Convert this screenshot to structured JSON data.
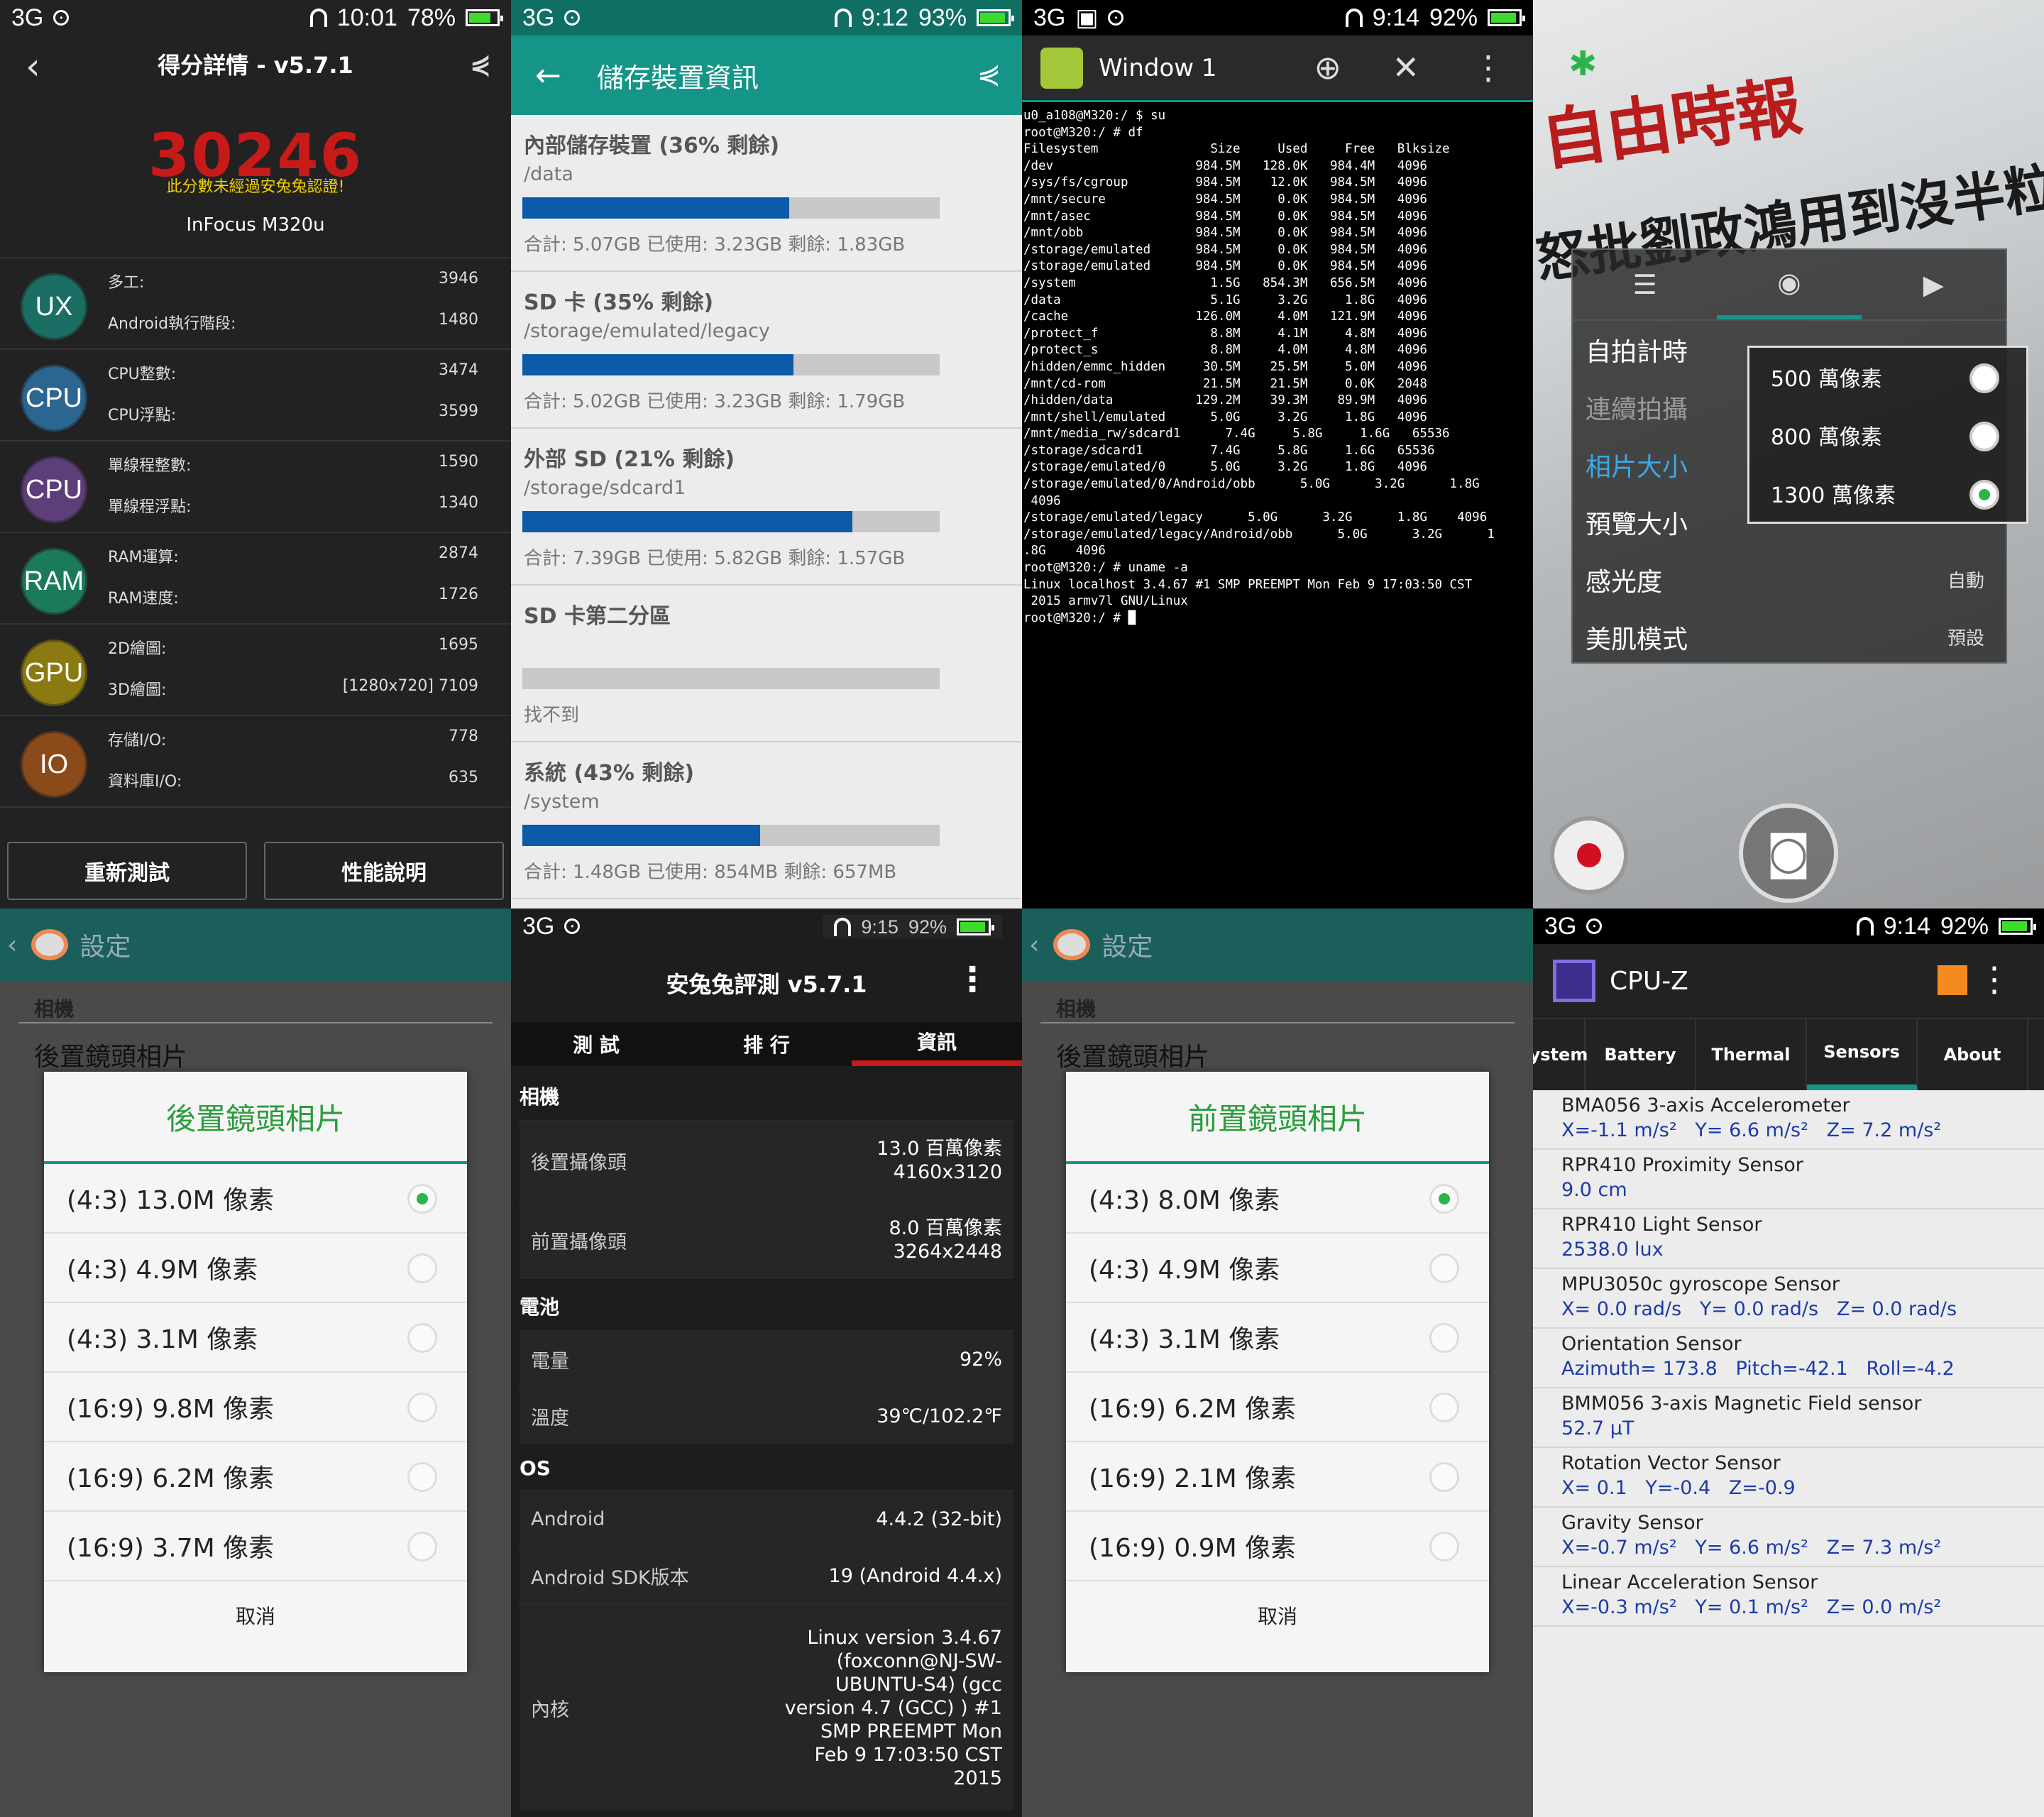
{
  "p1": {
    "status": {
      "network": "3G",
      "time": "10:01",
      "battery": "78%",
      "level": 0.78
    },
    "title": "得分詳情 - v5.7.1",
    "score": "30246",
    "warning": "此分數未經過安兔兔認證!",
    "device": "InFocus M320u",
    "rows": [
      {
        "badge": "UX",
        "color": "#1b6e63",
        "items": [
          [
            "多工:",
            "3946"
          ],
          [
            "Android執行階段:",
            "1480"
          ]
        ]
      },
      {
        "badge": "CPU",
        "color": "#2b6690",
        "items": [
          [
            "CPU整數:",
            "3474"
          ],
          [
            "CPU浮點:",
            "3599"
          ]
        ]
      },
      {
        "badge": "CPU",
        "color": "#5c3e79",
        "items": [
          [
            "單線程整數:",
            "1590"
          ],
          [
            "單線程浮點:",
            "1340"
          ]
        ]
      },
      {
        "badge": "RAM",
        "color": "#1b7a5c",
        "items": [
          [
            "RAM運算:",
            "2874"
          ],
          [
            "RAM速度:",
            "1726"
          ]
        ]
      },
      {
        "badge": "GPU",
        "color": "#8b7a12",
        "items": [
          [
            "2D繪圖:",
            "1695"
          ],
          [
            "3D繪圖:",
            "[1280x720] 7109"
          ]
        ]
      },
      {
        "badge": "IO",
        "color": "#8a4a1a",
        "items": [
          [
            "存儲I/O:",
            "778"
          ],
          [
            "資料庫I/O:",
            "635"
          ]
        ]
      }
    ],
    "retest": "重新測試",
    "explain": "性能說明"
  },
  "p2": {
    "status": {
      "network": "3G",
      "time": "9:12",
      "battery": "93%",
      "level": 0.93
    },
    "title": "儲存裝置資訊",
    "cards": [
      {
        "title": "內部儲存裝置 (36% 剩餘)",
        "sub": "/data",
        "used": 0.64,
        "info": "合計: 5.07GB 已使用: 3.23GB 剩餘: 1.83GB"
      },
      {
        "title": "SD 卡 (35% 剩餘)",
        "sub": "/storage/emulated/legacy",
        "used": 0.65,
        "info": "合計: 5.02GB 已使用: 3.23GB 剩餘: 1.79GB"
      },
      {
        "title": "外部 SD (21% 剩餘)",
        "sub": "/storage/sdcard1",
        "used": 0.79,
        "info": "合計: 7.39GB 已使用: 5.82GB 剩餘: 1.57GB"
      },
      {
        "title": "SD 卡第二分區",
        "sub": "",
        "used": 0,
        "info": "找不到"
      },
      {
        "title": "系統 (43% 剩餘)",
        "sub": "/system",
        "used": 0.57,
        "info": "合計: 1.48GB 已使用: 854MB 剩餘: 657MB"
      }
    ]
  },
  "p3": {
    "status": {
      "network": "3G",
      "time": "9:14",
      "battery": "92%",
      "level": 0.92
    },
    "title": "Window 1",
    "terminal": "u0_a108@M320:/ $ su\nroot@M320:/ # df\nFilesystem               Size     Used     Free   Blksize\n/dev                   984.5M   128.0K   984.4M   4096\n/sys/fs/cgroup         984.5M    12.0K   984.5M   4096\n/mnt/secure            984.5M     0.0K   984.5M   4096\n/mnt/asec              984.5M     0.0K   984.5M   4096\n/mnt/obb               984.5M     0.0K   984.5M   4096\n/storage/emulated      984.5M     0.0K   984.5M   4096\n/storage/emulated      984.5M     0.0K   984.5M   4096\n/system                  1.5G   854.3M   656.5M   4096\n/data                    5.1G     3.2G     1.8G   4096\n/cache                 126.0M     4.0M   121.9M   4096\n/protect_f               8.8M     4.1M     4.8M   4096\n/protect_s               8.8M     4.0M     4.8M   4096\n/hidden/emmc_hidden     30.5M    25.5M     5.0M   4096\n/mnt/cd-rom             21.5M    21.5M     0.0K   2048\n/hidden/data           129.2M    39.3M    89.9M   4096\n/mnt/shell/emulated      5.0G     3.2G     1.8G   4096\n/mnt/media_rw/sdcard1      7.4G     5.8G     1.6G   65536\n/storage/sdcard1         7.4G     5.8G     1.6G   65536\n/storage/emulated/0      5.0G     3.2G     1.8G   4096\n/storage/emulated/0/Android/obb      5.0G      3.2G      1.8G\n 4096\n/storage/emulated/legacy      5.0G      3.2G      1.8G    4096\n/storage/emulated/legacy/Android/obb      5.0G      3.2G      1\n.8G    4096\nroot@M320:/ # uname -a\nLinux localhost 3.4.67 #1 SMP PREEMPT Mon Feb 9 17:03:50 CST\n 2015 armv7l GNU/Linux\nroot@M320:/ # █"
  },
  "p4": {
    "menu": [
      {
        "label": "自拍計時",
        "value": "",
        "color": "#fff"
      },
      {
        "label": "連續拍攝",
        "value": "",
        "color": "#999"
      },
      {
        "label": "相片大小",
        "value": "",
        "color": "#3aa8e8"
      },
      {
        "label": "預覽大小",
        "value": "",
        "color": "#fff"
      },
      {
        "label": "感光度",
        "value": "自動",
        "color": "#fff"
      },
      {
        "label": "美肌模式",
        "value": "預設",
        "color": "#fff"
      }
    ],
    "options": [
      {
        "label": "500 萬像素",
        "sel": false
      },
      {
        "label": "800 萬像素",
        "sel": false
      },
      {
        "label": "1300 萬像素",
        "sel": true
      }
    ],
    "newspaper": "自由時報",
    "headline": "怒批劉政鴻用到沒半粒米"
  },
  "p5": {
    "header": "設定",
    "category": "相機",
    "item": "後置鏡頭相片",
    "dialog_title": "後置鏡頭相片",
    "options": [
      {
        "label": "(4:3) 13.0M 像素",
        "sel": true
      },
      {
        "label": "(4:3) 4.9M 像素",
        "sel": false
      },
      {
        "label": "(4:3) 3.1M 像素",
        "sel": false
      },
      {
        "label": "(16:9) 9.8M 像素",
        "sel": false
      },
      {
        "label": "(16:9) 6.2M 像素",
        "sel": false
      },
      {
        "label": "(16:9) 3.7M 像素",
        "sel": false
      }
    ],
    "cancel": "取消"
  },
  "p6": {
    "status": {
      "network": "3G",
      "time": "9:15",
      "battery": "92%",
      "level": 0.92
    },
    "title": "安兔兔評測 v5.7.1",
    "tabs": [
      "測 試",
      "排 行",
      "資訊"
    ],
    "sections": [
      {
        "name": "相機",
        "rows": [
          [
            "後置攝像頭",
            "13.0 百萬像素\n4160x3120"
          ],
          [
            "前置攝像頭",
            "8.0 百萬像素\n3264x2448"
          ]
        ]
      },
      {
        "name": "電池",
        "rows": [
          [
            "電量",
            "92%"
          ],
          [
            "溫度",
            "39℃/102.2℉"
          ]
        ]
      },
      {
        "name": "OS",
        "rows": [
          [
            "Android",
            "4.4.2 (32-bit)"
          ],
          [
            "Android SDK版本",
            "19  (Android 4.4.x)"
          ],
          [
            "內核",
            "Linux version 3.4.67\n(foxconn@NJ-SW-\nUBUNTU-S4) (gcc\nversion 4.7 (GCC) ) #1\nSMP PREEMPT Mon\nFeb 9 17:03:50 CST\n2015"
          ]
        ]
      }
    ]
  },
  "p7": {
    "header": "設定",
    "category": "相機",
    "item": "後置鏡頭相片",
    "dialog_title": "前置鏡頭相片",
    "options": [
      {
        "label": "(4:3) 8.0M 像素",
        "sel": true
      },
      {
        "label": "(4:3) 4.9M 像素",
        "sel": false
      },
      {
        "label": "(4:3) 3.1M 像素",
        "sel": false
      },
      {
        "label": "(16:9) 6.2M 像素",
        "sel": false
      },
      {
        "label": "(16:9) 2.1M 像素",
        "sel": false
      },
      {
        "label": "(16:9) 0.9M 像素",
        "sel": false
      }
    ],
    "cancel": "取消"
  },
  "p8": {
    "status": {
      "network": "3G",
      "time": "9:14",
      "battery": "92%",
      "level": 0.92
    },
    "title": "CPU-Z",
    "tabs": [
      "ystem",
      "Battery",
      "Thermal",
      "Sensors",
      "About"
    ],
    "sensors": [
      [
        "BMA056 3-axis Accelerometer",
        "X=-1.1 m/s²   Y= 6.6 m/s²   Z= 7.2 m/s²"
      ],
      [
        "RPR410  Proximity Sensor",
        "9.0 cm"
      ],
      [
        "RPR410 Light Sensor",
        "2538.0 lux"
      ],
      [
        "MPU3050c gyroscope Sensor",
        "X= 0.0 rad/s   Y= 0.0 rad/s   Z= 0.0 rad/s"
      ],
      [
        "Orientation Sensor",
        "Azimuth= 173.8   Pitch=-42.1   Roll=-4.2"
      ],
      [
        "BMM056 3-axis Magnetic Field sensor",
        "52.7 μT"
      ],
      [
        "Rotation Vector Sensor",
        "X= 0.1   Y=-0.4   Z=-0.9"
      ],
      [
        "Gravity Sensor",
        "X=-0.7 m/s²   Y= 6.6 m/s²   Z= 7.3 m/s²"
      ],
      [
        "Linear Acceleration Sensor",
        "X=-0.3 m/s²   Y= 0.1 m/s²   Z= 0.0 m/s²"
      ]
    ]
  }
}
